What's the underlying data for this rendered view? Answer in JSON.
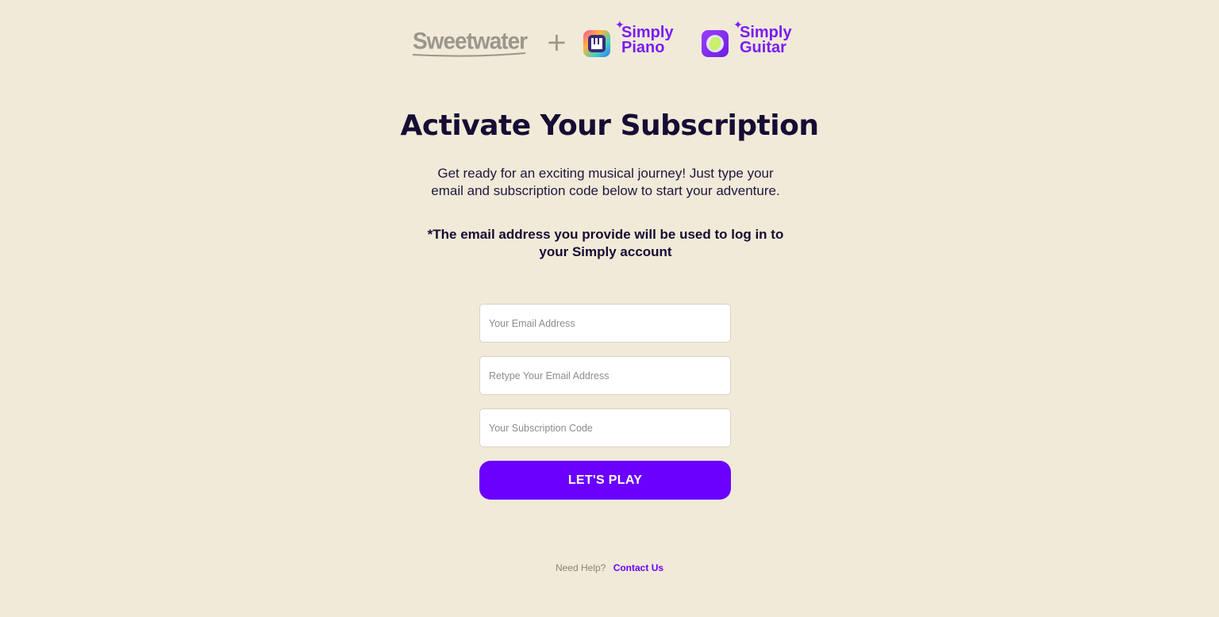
{
  "header": {
    "partner_logo": "Sweetwater",
    "plus": "+",
    "apps": [
      {
        "icon": "simply-piano-icon",
        "name_line1": "Simply",
        "name_line2": "Piano"
      },
      {
        "icon": "simply-guitar-icon",
        "name_line1": "Simply",
        "name_line2": "Guitar"
      }
    ]
  },
  "main": {
    "title": "Activate Your Subscription",
    "subtitle": "Get ready for an exciting musical journey! Just type your email and subscription code below to start your adventure.",
    "note": "*The email address you provide will be used to log in to your Simply account"
  },
  "form": {
    "email_placeholder": "Your Email Address",
    "email_confirm_placeholder": "Retype Your Email Address",
    "code_placeholder": "Your Subscription Code",
    "submit_label": "LET'S PLAY"
  },
  "footer": {
    "help_text": "Need Help?",
    "contact_label": "Contact Us"
  },
  "colors": {
    "background": "#f1ead8",
    "accent": "#6a00ff",
    "text": "#160c34"
  }
}
